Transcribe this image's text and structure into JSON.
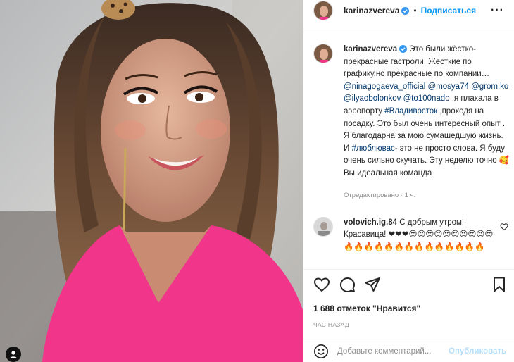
{
  "post": {
    "username": "karinazvereva",
    "follow_label": "Подписаться",
    "more_label": "···"
  },
  "caption": {
    "username": "karinazvereva",
    "line_1": "Это были жёстко-прекрасные гастроли. Жесткие по графику,но прекрасные по компании…",
    "mention_1": "@ninagogaeva_official",
    "mention_2": "@mosya74",
    "mention_3": "@grom.ko",
    "mention_4": "@ilyaobolonkov",
    "mention_5": "@to100nado",
    "line_2": ",я плакала в аэропорту",
    "hashtag_1": "#Владивосток",
    "line_3": ",проходя на посадку. Это был очень интересный опыт . Я благодарна за мою сумашедшую жизнь. И",
    "hashtag_2": "#люблювас",
    "line_4": "- это не просто слова. Я буду очень сильно скучать. Эту неделю точно 🥰 Вы идеальная команда",
    "edited": "Отредактировано · 1 ч."
  },
  "comment": {
    "username": "volovich.ig.84",
    "text": "С добрым утром! Красавица! ❤❤❤😍😍😍😍😍😍😍😍😍😍🔥🔥🔥🔥🔥🔥🔥🔥🔥🔥🔥🔥🔥🔥"
  },
  "stats": {
    "likes": "1 688 отметок \"Нравится\"",
    "time": "ЧАС НАЗАД"
  },
  "composer": {
    "placeholder": "Добавьте комментарий...",
    "publish_label": "Опубликовать"
  },
  "icons": [
    "heart-icon",
    "comment-icon",
    "share-icon",
    "bookmark-icon",
    "smiley-icon",
    "verified-icon",
    "tag-people-icon"
  ],
  "colors": {
    "accent": "#0095f6",
    "link": "#00376b",
    "muted": "#8e8e8e",
    "dress": "#f0358a"
  }
}
